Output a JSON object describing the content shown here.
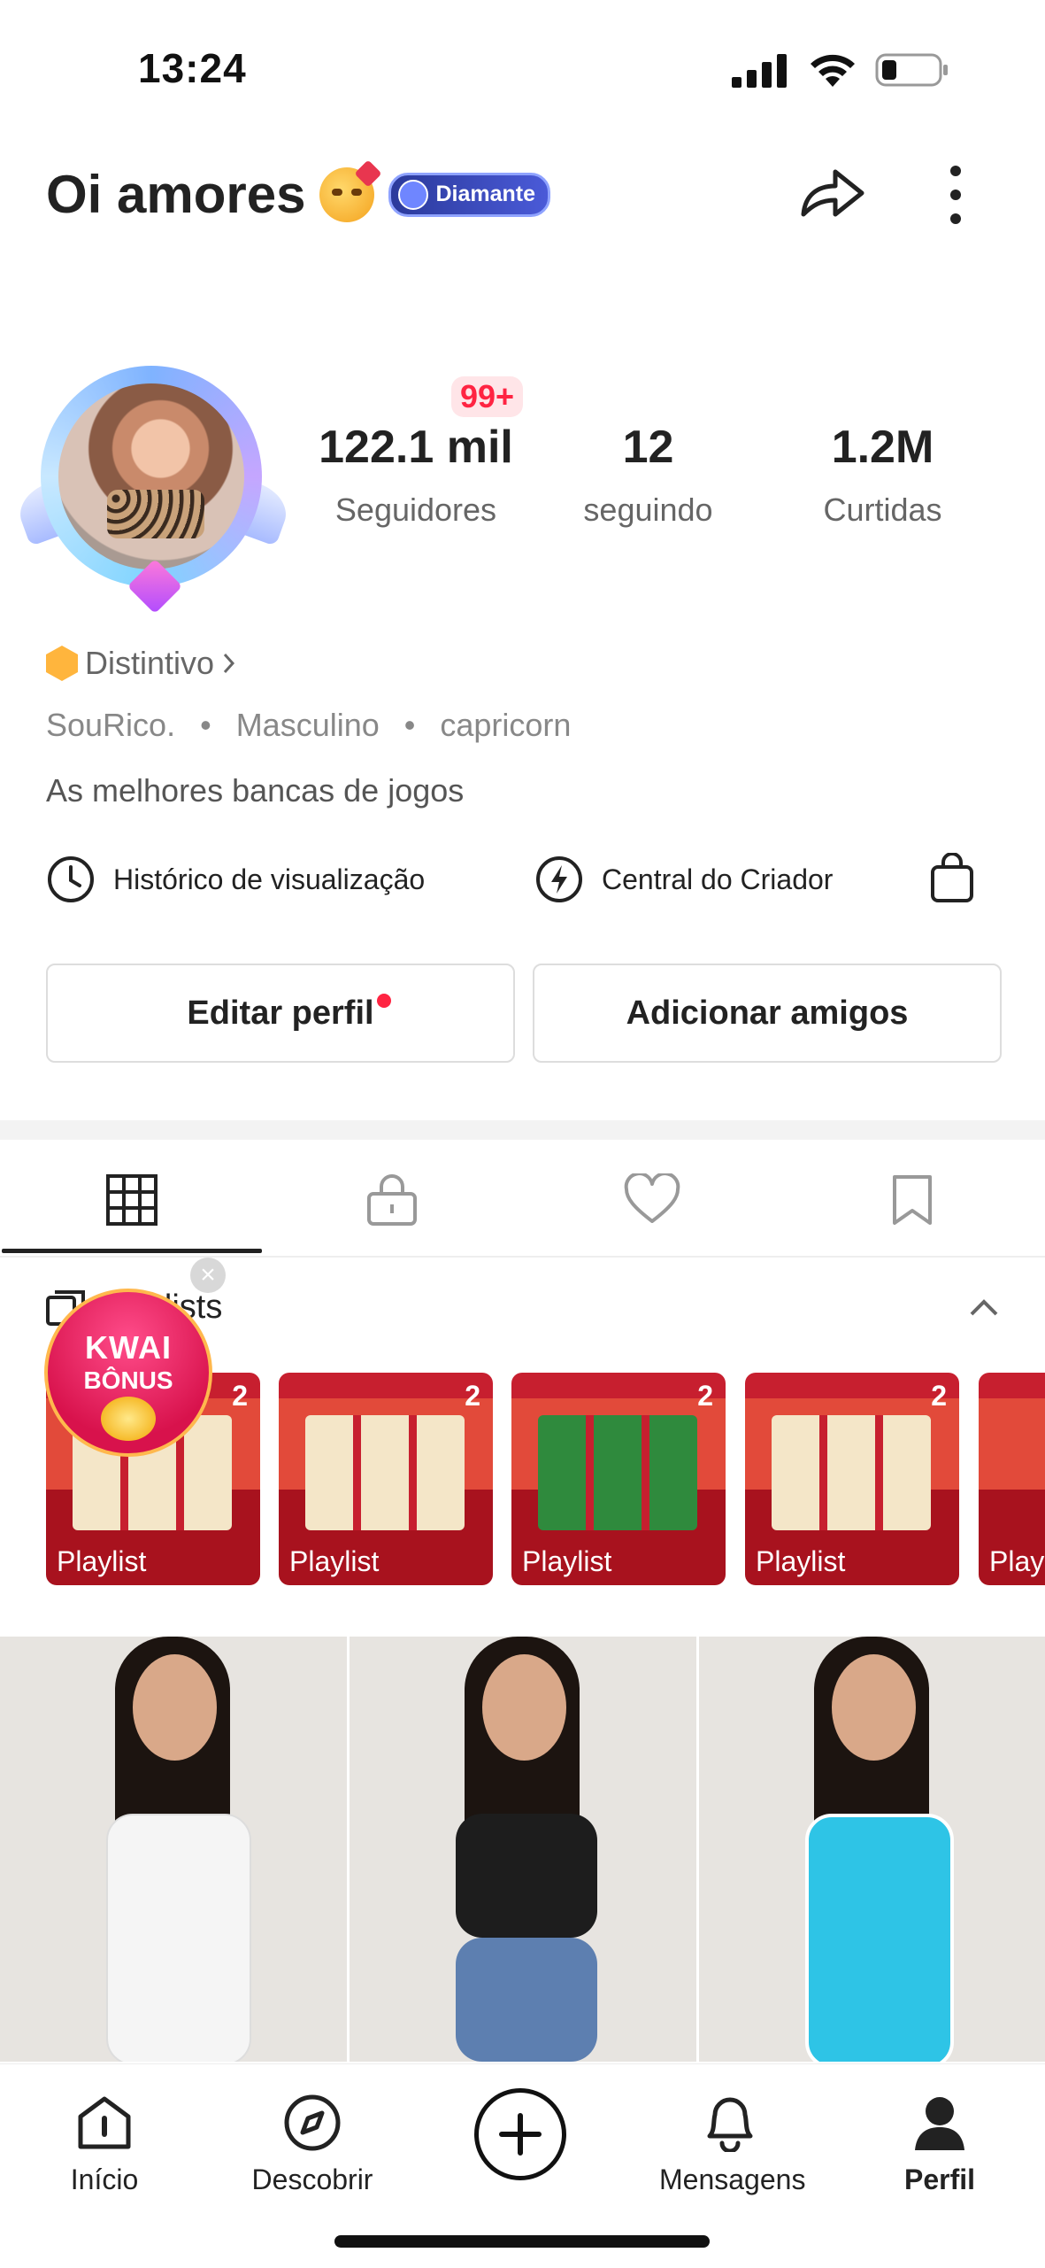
{
  "status_bar": {
    "time": "13:24"
  },
  "header": {
    "title": "Oi amores",
    "level_badge": "Diamante"
  },
  "profile": {
    "notification_badge": "99+",
    "stats": [
      {
        "value": "122.1 mil",
        "label": "Seguidores"
      },
      {
        "value": "12",
        "label": "seguindo"
      },
      {
        "value": "1.2M",
        "label": "Curtidas"
      }
    ],
    "distintivo": "Distintivo",
    "meta": [
      "SouRico.",
      "Masculino",
      "capricorn"
    ],
    "bio": "As melhores bancas de jogos"
  },
  "quick_links": {
    "history": "Histórico de visualização",
    "creator": "Central do Criador"
  },
  "actions": {
    "edit": "Editar perfil",
    "add_friends": "Adicionar amigos"
  },
  "playlists": {
    "heading": "Playlists",
    "items": [
      {
        "label": "Playlist",
        "count": "2"
      },
      {
        "label": "Playlist",
        "count": "2"
      },
      {
        "label": "Playlist",
        "count": "2"
      },
      {
        "label": "Playlist",
        "count": "2"
      },
      {
        "label": "Play",
        "count": ""
      }
    ]
  },
  "kwai_bonus": {
    "line1": "KWAI",
    "line2": "BÔNUS"
  },
  "nav": {
    "home": "Início",
    "discover": "Descobrir",
    "messages": "Mensagens",
    "profile": "Perfil"
  }
}
